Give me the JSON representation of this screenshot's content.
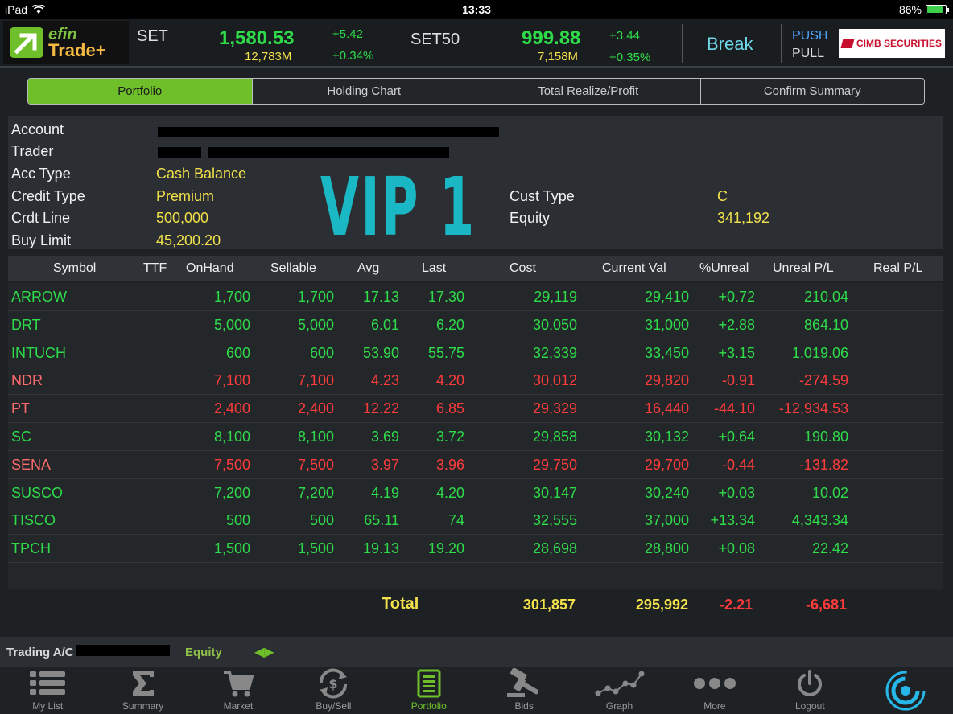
{
  "statusbar": {
    "device": "iPad",
    "time": "13:33",
    "battery": "86%"
  },
  "header": {
    "logo_top": "efin",
    "logo_bottom": "Trade+",
    "set": {
      "name": "SET",
      "value": "1,580.53",
      "volume": "12,783M",
      "change": "+5.42",
      "change_pct": "+0.34%"
    },
    "set50": {
      "name": "SET50",
      "value": "999.88",
      "volume": "7,158M",
      "change": "+3.44",
      "change_pct": "+0.35%"
    },
    "market_status": "Break",
    "push": "PUSH",
    "pull": "PULL",
    "broker": "CIMB SECURITIES"
  },
  "tabs": [
    {
      "label": "Portfolio",
      "active": true
    },
    {
      "label": "Holding Chart",
      "active": false
    },
    {
      "label": "Total Realize/Profit",
      "active": false
    },
    {
      "label": "Confirm Summary",
      "active": false
    }
  ],
  "account": {
    "labels": {
      "account": "Account",
      "trader": "Trader",
      "acc_type": "Acc Type",
      "credit_type": "Credit Type",
      "crdt_line": "Crdt Line",
      "buy_limit": "Buy Limit",
      "cust_type": "Cust Type",
      "equity": "Equity"
    },
    "acc_type": "Cash Balance",
    "credit_type": "Premium",
    "crdt_line": "500,000",
    "buy_limit": "45,200.20",
    "cust_type": "C",
    "equity": "341,192",
    "overlay": "VIP 1"
  },
  "table": {
    "columns": [
      "Symbol",
      "TTF",
      "OnHand",
      "Sellable",
      "Avg",
      "Last",
      "Cost",
      "Current Val",
      "%Unreal",
      "Unreal P/L",
      "Real P/L"
    ],
    "rows": [
      {
        "symbol": "ARROW",
        "onhand": "1,700",
        "sellable": "1,700",
        "avg": "17.13",
        "last": "17.30",
        "cost": "29,119",
        "current": "29,410",
        "pct": "+0.72",
        "unreal": "210.04",
        "up": true
      },
      {
        "symbol": "DRT",
        "onhand": "5,000",
        "sellable": "5,000",
        "avg": "6.01",
        "last": "6.20",
        "cost": "30,050",
        "current": "31,000",
        "pct": "+2.88",
        "unreal": "864.10",
        "up": true
      },
      {
        "symbol": "INTUCH",
        "onhand": "600",
        "sellable": "600",
        "avg": "53.90",
        "last": "55.75",
        "cost": "32,339",
        "current": "33,450",
        "pct": "+3.15",
        "unreal": "1,019.06",
        "up": true
      },
      {
        "symbol": "NDR",
        "onhand": "7,100",
        "sellable": "7,100",
        "avg": "4.23",
        "last": "4.20",
        "cost": "30,012",
        "current": "29,820",
        "pct": "-0.91",
        "unreal": "-274.59",
        "up": false
      },
      {
        "symbol": "PT",
        "onhand": "2,400",
        "sellable": "2,400",
        "avg": "12.22",
        "last": "6.85",
        "cost": "29,329",
        "current": "16,440",
        "pct": "-44.10",
        "unreal": "-12,934.53",
        "up": false
      },
      {
        "symbol": "SC",
        "onhand": "8,100",
        "sellable": "8,100",
        "avg": "3.69",
        "last": "3.72",
        "cost": "29,858",
        "current": "30,132",
        "pct": "+0.64",
        "unreal": "190.80",
        "up": true
      },
      {
        "symbol": "SENA",
        "onhand": "7,500",
        "sellable": "7,500",
        "avg": "3.97",
        "last": "3.96",
        "cost": "29,750",
        "current": "29,700",
        "pct": "-0.44",
        "unreal": "-131.82",
        "up": false
      },
      {
        "symbol": "SUSCO",
        "onhand": "7,200",
        "sellable": "7,200",
        "avg": "4.19",
        "last": "4.20",
        "cost": "30,147",
        "current": "30,240",
        "pct": "+0.03",
        "unreal": "10.02",
        "up": true
      },
      {
        "symbol": "TISCO",
        "onhand": "500",
        "sellable": "500",
        "avg": "65.11",
        "last": "74",
        "cost": "32,555",
        "current": "37,000",
        "pct": "+13.34",
        "unreal": "4,343.34",
        "up": true
      },
      {
        "symbol": "TPCH",
        "onhand": "1,500",
        "sellable": "1,500",
        "avg": "19.13",
        "last": "19.20",
        "cost": "28,698",
        "current": "28,800",
        "pct": "+0.08",
        "unreal": "22.42",
        "up": true
      }
    ],
    "total": {
      "label": "Total",
      "cost": "301,857",
      "current": "295,992",
      "pct": "-2.21",
      "unreal": "-6,681"
    }
  },
  "trading": {
    "label": "Trading A/C",
    "equity": "Equity",
    "arrows": "◀▶"
  },
  "nav": [
    {
      "label": "My List",
      "icon": "list-icon"
    },
    {
      "label": "Summary",
      "icon": "sigma-icon"
    },
    {
      "label": "Market",
      "icon": "cart-icon"
    },
    {
      "label": "Buy/Sell",
      "icon": "buysell-icon"
    },
    {
      "label": "Portfolio",
      "icon": "portfolio-icon",
      "active": true
    },
    {
      "label": "Bids",
      "icon": "gavel-icon"
    },
    {
      "label": "Graph",
      "icon": "graph-icon"
    },
    {
      "label": "More",
      "icon": "more-icon"
    },
    {
      "label": "Logout",
      "icon": "power-icon"
    }
  ],
  "colors": {
    "up": "#2edc4a",
    "down": "#ff3b3b",
    "accent": "#6fbf2a",
    "value": "#f2e14b"
  }
}
